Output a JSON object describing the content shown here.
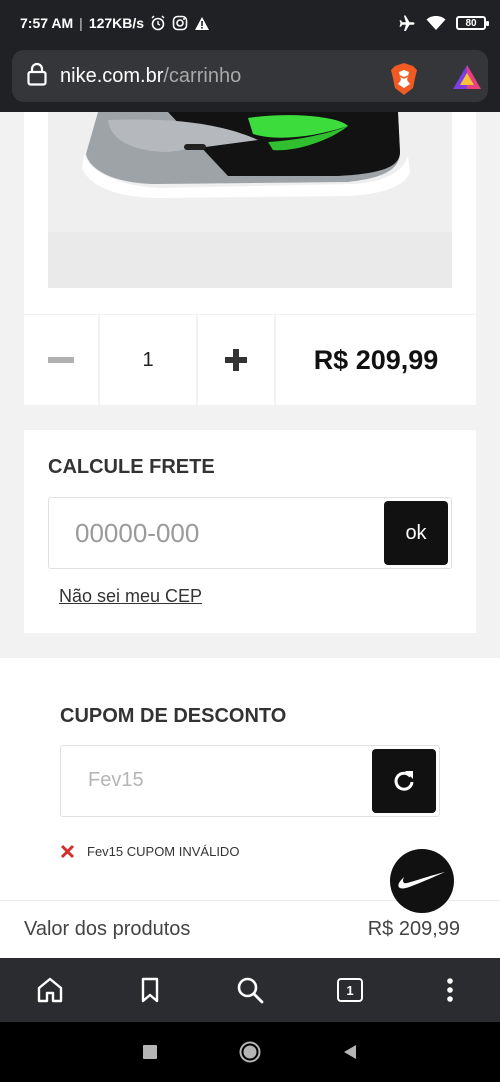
{
  "status_bar": {
    "time": "7:57 AM",
    "speed": "127KB/s",
    "battery": "80"
  },
  "browser": {
    "url_domain": "nike.com.br",
    "url_path": "/carrinho",
    "tab_count": "1"
  },
  "cart": {
    "quantity": "1",
    "price": "R$ 209,99"
  },
  "shipping": {
    "title": "CALCULE FRETE",
    "cep_placeholder": "00000-000",
    "ok_label": "ok",
    "dont_know_cep": "Não sei meu CEP"
  },
  "coupon": {
    "title": "CUPOM DE DESCONTO",
    "value": "Fev15",
    "error_text": "Fev15 CUPOM INVÁLIDO"
  },
  "summary": {
    "products_label": "Valor dos produtos",
    "products_value": "R$ 209,99"
  },
  "colors": {
    "accent_green": "#3ddc3d",
    "error_red": "#d32f2f",
    "dark": "#111111",
    "brave_orange": "#f15a22"
  }
}
